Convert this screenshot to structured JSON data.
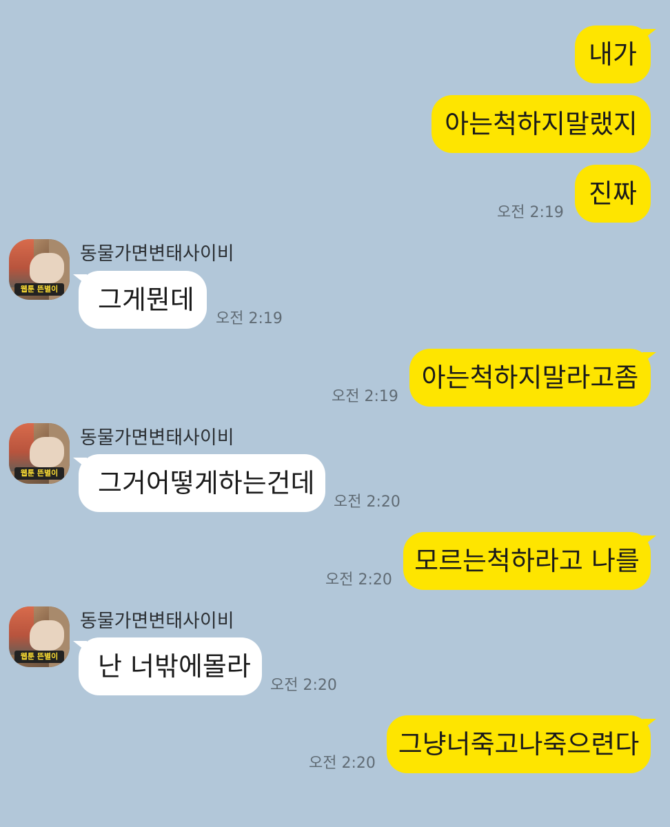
{
  "contact": {
    "name": "동물가면변태사이비",
    "avatar_icon": "profile-photo-icon",
    "avatar_caption": "웹툰 뜬별이"
  },
  "messages": [
    {
      "from": "me",
      "text": "내가"
    },
    {
      "from": "me",
      "text": "아는척하지말랬지"
    },
    {
      "from": "me",
      "text": "진짜",
      "time": "오전 2:19"
    },
    {
      "from": "them",
      "sender": "동물가면변태사이비",
      "text": "그게뭔데",
      "time": "오전 2:19"
    },
    {
      "from": "me",
      "text": "아는척하지말라고좀",
      "time": "오전 2:19"
    },
    {
      "from": "them",
      "sender": "동물가면변태사이비",
      "text": "그거어떻게하는건데",
      "time": "오전 2:20"
    },
    {
      "from": "me",
      "text": "모르는척하라고 나를",
      "time": "오전 2:20"
    },
    {
      "from": "them",
      "sender": "동물가면변태사이비",
      "text": "난 너밖에몰라",
      "time": "오전 2:20"
    },
    {
      "from": "me",
      "text": "그냥너죽고나죽으련다",
      "time": "오전 2:20"
    }
  ],
  "colors": {
    "background": "#b2c7d9",
    "sent_bubble": "#fee500",
    "received_bubble": "#ffffff",
    "timestamp": "#606b74"
  }
}
